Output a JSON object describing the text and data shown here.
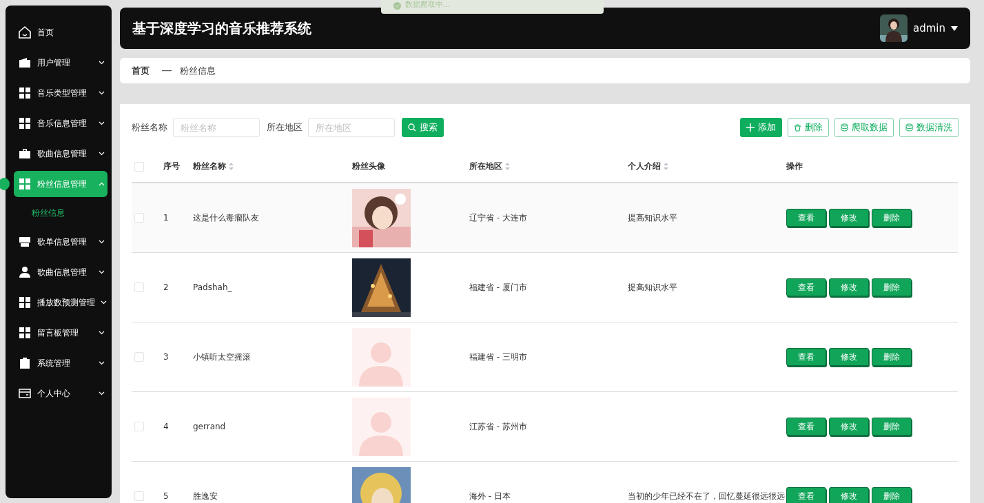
{
  "toast": {
    "text": "数据爬取中..."
  },
  "sidebar": {
    "items": [
      {
        "label": "首页",
        "expandable": false,
        "selected": false
      },
      {
        "label": "用户管理",
        "expandable": true,
        "selected": false,
        "expanded": false
      },
      {
        "label": "音乐类型管理",
        "expandable": true,
        "selected": false,
        "expanded": false
      },
      {
        "label": "音乐信息管理",
        "expandable": true,
        "selected": false,
        "expanded": false
      },
      {
        "label": "歌曲信息管理",
        "expandable": true,
        "selected": false,
        "expanded": false
      },
      {
        "label": "粉丝信息管理",
        "expandable": true,
        "selected": true,
        "expanded": true,
        "children": [
          {
            "label": "粉丝信息",
            "selected": true
          }
        ]
      },
      {
        "label": "歌单信息管理",
        "expandable": true,
        "selected": false,
        "expanded": false
      },
      {
        "label": "歌曲信息管理",
        "expandable": true,
        "selected": false,
        "expanded": false
      },
      {
        "label": "播放数预测管理",
        "expandable": true,
        "selected": false,
        "expanded": false
      },
      {
        "label": "留言板管理",
        "expandable": true,
        "selected": false,
        "expanded": false
      },
      {
        "label": "系统管理",
        "expandable": true,
        "selected": false,
        "expanded": false
      },
      {
        "label": "个人中心",
        "expandable": true,
        "selected": false,
        "expanded": false
      }
    ]
  },
  "header": {
    "title": "基于深度学习的音乐推荐系统",
    "user": "admin"
  },
  "breadcrumb": [
    "首页",
    "粉丝信息"
  ],
  "filters": [
    {
      "label": "粉丝名称",
      "placeholder": "粉丝名称"
    },
    {
      "label": "所在地区",
      "placeholder": "所在地区"
    }
  ],
  "search_button": "搜索",
  "toolbar": [
    {
      "label": "添加",
      "kind": "primary"
    },
    {
      "label": "删除",
      "kind": "trash"
    },
    {
      "label": "爬取数据",
      "kind": "data"
    },
    {
      "label": "数据清洗",
      "kind": "data"
    }
  ],
  "table": {
    "select_all_checked": false,
    "columns": [
      {
        "label": "序号",
        "sortable": false
      },
      {
        "label": "粉丝名称",
        "sortable": true
      },
      {
        "label": "粉丝头像",
        "sortable": false
      },
      {
        "label": "所在地区",
        "sortable": true
      },
      {
        "label": "个人介绍",
        "sortable": true
      },
      {
        "label": "操作",
        "sortable": false
      }
    ],
    "rows": [
      {
        "checked": false,
        "index": "1",
        "name": "这是什么毒瘤队友",
        "avatar": {
          "kind": "picture"
        },
        "region": "辽宁省 - 大连市",
        "intro": "提高知识水平",
        "actions": [
          "查看",
          "修改",
          "删除"
        ]
      },
      {
        "checked": false,
        "index": "2",
        "name": "Padshah_",
        "avatar": {
          "kind": "picture"
        },
        "region": "福建省 - 厦门市",
        "intro": "提高知识水平",
        "actions": [
          "查看",
          "修改",
          "删除"
        ]
      },
      {
        "checked": false,
        "index": "3",
        "name": "小镇听太空摇滚",
        "avatar": {
          "kind": "placeholder"
        },
        "region": "福建省 - 三明市",
        "actions": [
          "查看",
          "修改",
          "删除"
        ]
      },
      {
        "checked": false,
        "index": "4",
        "name": "gerrand",
        "avatar": {
          "kind": "placeholder"
        },
        "region": "江苏省 - 苏州市",
        "actions": [
          "查看",
          "修改",
          "删除"
        ]
      },
      {
        "checked": false,
        "index": "5",
        "name": "胜逸安",
        "avatar": {
          "kind": "picture"
        },
        "region": "海外 - 日本",
        "intro": "当初的少年已经不在了，回忆蔓延很远很远",
        "actions": [
          "查看",
          "修改",
          "删除"
        ]
      }
    ]
  }
}
